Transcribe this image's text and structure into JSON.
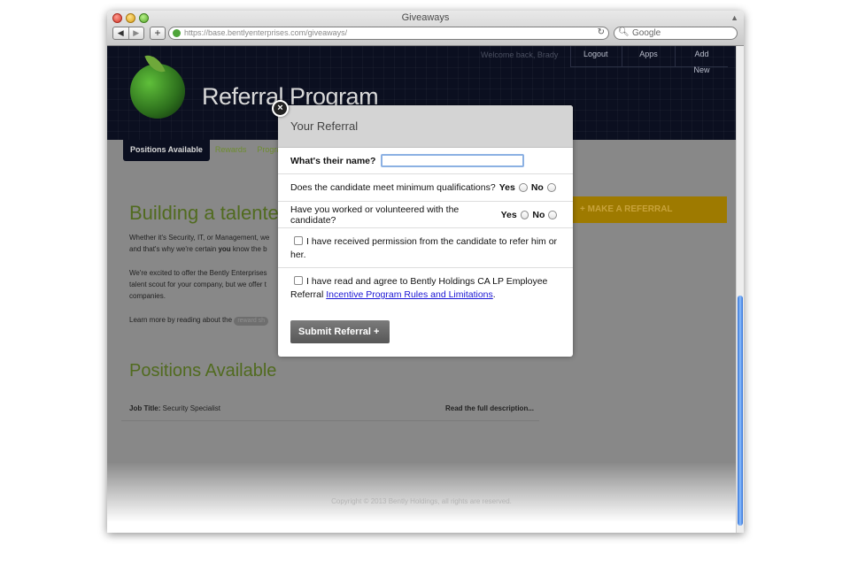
{
  "browser": {
    "window_title": "Giveaways",
    "url": "https://base.bentlyenterprises.com/giveaways/",
    "search_placeholder": "Google",
    "back_glyph": "◀",
    "forward_glyph": "▶",
    "add_tab_glyph": "+",
    "reload_glyph": "↻"
  },
  "header": {
    "site_title": "Referral Program",
    "welcome": "Welcome back, Brady",
    "nav": [
      "Logout",
      "Apps",
      "Add New"
    ]
  },
  "subnav": {
    "tabs": [
      "Positions Available",
      "Rewards",
      "Program"
    ]
  },
  "main": {
    "heading": "Building a talented",
    "para1_line1": "Whether it's Security, IT, or Management, we",
    "para1_line2_pre": "and that's why we're certain ",
    "para1_line2_bold": "you",
    "para1_line2_post": " know the b",
    "para2_line1": "We're excited to offer the Bently Enterprises",
    "para2_line2": "talent scout for your company, but we offer t",
    "para2_line3": "companies.",
    "learn_more": "Learn more by reading about the",
    "learn_pill": "reward sh",
    "cta_label": "+ MAKE A REFERRAL",
    "positions_heading": "Positions Available",
    "job_label": "Job Title:",
    "job_value": "Security Specialist",
    "job_link": "Read the full description...",
    "copyright": "Copyright © 2013 Bently Holdings, all rights are reserved."
  },
  "modal": {
    "close_glyph": "×",
    "title": "Your Referral",
    "name_label": "What's their name?",
    "q1_label": "Does the candidate meet minimum qualifications?",
    "q2_label": "Have you worked or volunteered with the candidate?",
    "yes": "Yes",
    "no": "No",
    "permission_text": "I have received permission from the candidate to refer him or her.",
    "agree_text": "I have read and agree to Bently Holdings CA LP Employee Referral ",
    "agree_link": "Incentive Program Rules and Limitations",
    "agree_end": ".",
    "submit_label": "Submit Referral  +"
  }
}
